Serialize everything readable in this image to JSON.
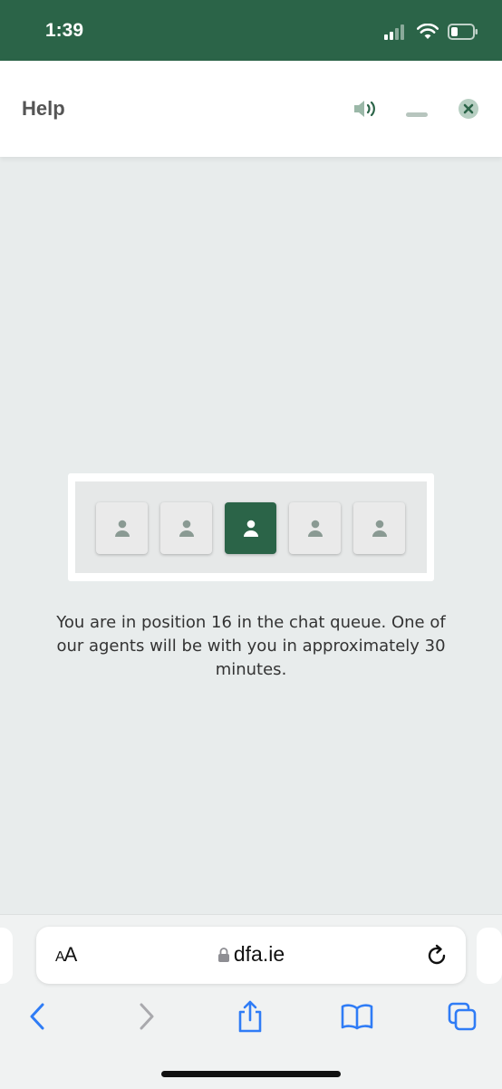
{
  "status_bar": {
    "time": "1:39",
    "icons": [
      "cellular-signal-icon",
      "wifi-icon",
      "battery-icon"
    ]
  },
  "help_header": {
    "title": "Help",
    "buttons": [
      "speaker-icon",
      "minimize-icon",
      "close-icon"
    ]
  },
  "queue": {
    "slots": 5,
    "active_slot": 3,
    "message": "You are in position 16 in the chat queue. One of our agents will be with you in approximately 30 minutes."
  },
  "browser": {
    "text_size_label_big": "A",
    "text_size_label_small": "A",
    "url": "dfa.ie",
    "nav_icons": [
      "back-icon",
      "forward-icon",
      "share-icon",
      "bookmarks-icon",
      "tabs-icon"
    ]
  },
  "colors": {
    "brand_green": "#2b6448",
    "background": "#e8ecec",
    "safari_blue": "#2f7cf6"
  }
}
